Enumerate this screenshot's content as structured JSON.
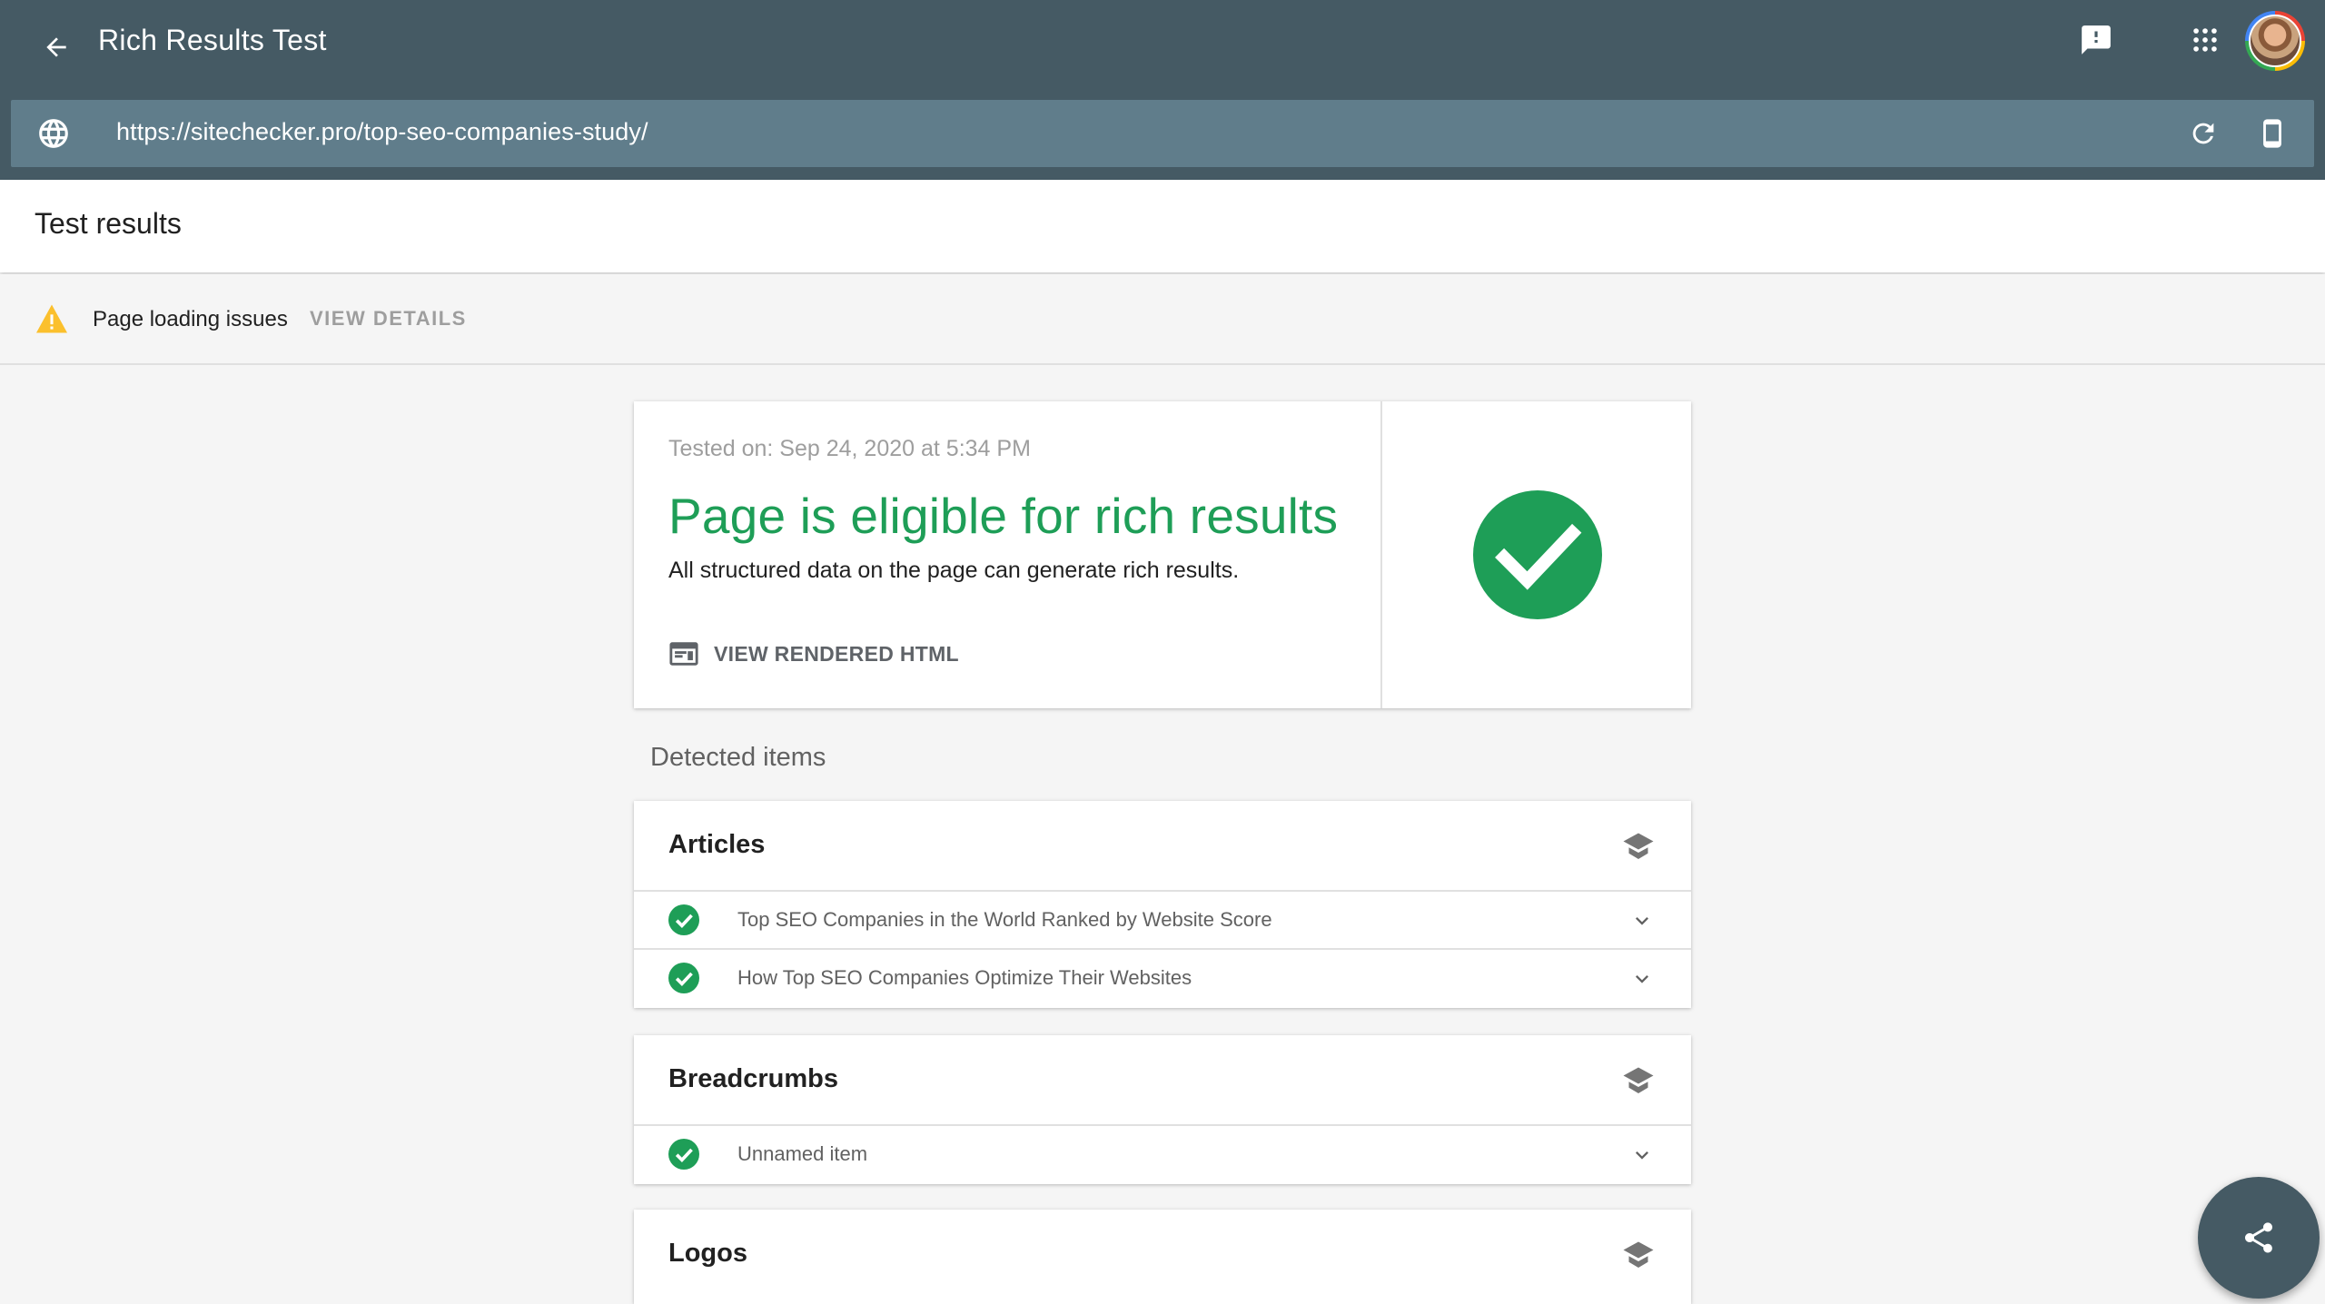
{
  "app": {
    "title": "Rich Results Test",
    "url": "https://sitechecker.pro/top-seo-companies-study/",
    "accent_color": "#455a64",
    "icons": [
      "back-arrow-icon",
      "feedback-icon",
      "apps-grid-icon",
      "globe-icon",
      "reload-icon",
      "smartphone-icon",
      "share-icon"
    ]
  },
  "results": {
    "title": "Test results"
  },
  "warning": {
    "text": "Page loading issues",
    "action": "VIEW DETAILS",
    "icon": "warning-icon",
    "color": "#fbc02d"
  },
  "summary": {
    "tested_on": "Tested on: Sep 24, 2020 at 5:34 PM",
    "headline": "Page is eligible for rich results",
    "subtext": "All structured data on the page can generate rich results.",
    "view_html": "VIEW RENDERED HTML",
    "status_color": "#1e9e57"
  },
  "detected": {
    "label": "Detected items",
    "cards": [
      {
        "title": "Articles",
        "items": [
          "Top SEO Companies in the World Ranked by Website Score",
          "How Top SEO Companies Optimize Their Websites"
        ]
      },
      {
        "title": "Breadcrumbs",
        "items": [
          "Unnamed item"
        ]
      },
      {
        "title": "Logos",
        "items": []
      }
    ]
  }
}
